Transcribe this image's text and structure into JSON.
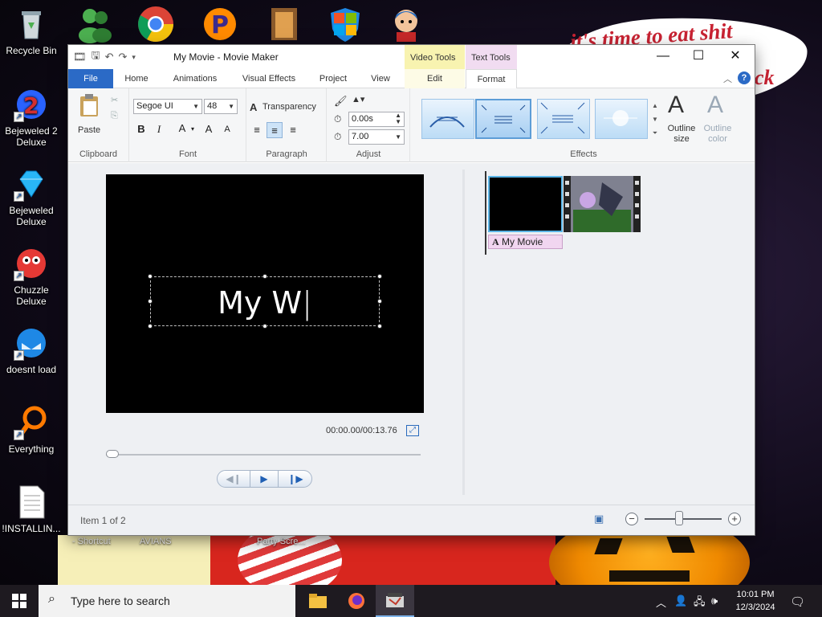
{
  "wallpaper": {
    "note_line1": "it's time to eat shit",
    "note_line2": "ck",
    "labels": [
      " - Shortcut",
      "AVIANS",
      "Party Scre..."
    ]
  },
  "desktop": {
    "icons": [
      {
        "label": "Recycle Bin"
      },
      {
        "label": "Bejeweled 2 Deluxe"
      },
      {
        "label": "Bejeweled Deluxe"
      },
      {
        "label": "Chuzzle Deluxe"
      },
      {
        "label": "doesnt load"
      },
      {
        "label": "Everything"
      },
      {
        "label": "!INSTALLIN..."
      }
    ]
  },
  "window": {
    "title": "My Movie - Movie Maker",
    "context_groups": {
      "video_tools": "Video Tools",
      "text_tools": "Text Tools"
    },
    "tabs": [
      {
        "label": "File"
      },
      {
        "label": "Home"
      },
      {
        "label": "Animations"
      },
      {
        "label": "Visual Effects"
      },
      {
        "label": "Project"
      },
      {
        "label": "View"
      },
      {
        "label": "Edit"
      },
      {
        "label": "Format"
      }
    ],
    "active_tab": "Format",
    "ribbon": {
      "clipboard": {
        "label": "Clipboard",
        "paste": "Paste"
      },
      "font": {
        "label": "Font",
        "family": "Segoe UI",
        "size": "48",
        "bold": "B",
        "italic": "I",
        "color": "A",
        "grow": "A",
        "shrink": "A"
      },
      "paragraph": {
        "label": "Paragraph",
        "transparency": "Transparency"
      },
      "adjust": {
        "label": "Adjust",
        "start_time": "0.00s",
        "duration": "7.00"
      },
      "effects": {
        "label": "Effects",
        "outline_size": "Outline size",
        "outline_color": "Outline color",
        "outline_glyph": "A"
      }
    },
    "preview": {
      "caption_text": "My W",
      "timecode": "00:00.00/00:13.76",
      "seek_position": 0
    },
    "storyboard": {
      "title_clip_label": "My Movie"
    },
    "status": {
      "item_text": "Item 1 of 2",
      "zoom_level": 0.45
    }
  },
  "taskbar": {
    "search_placeholder": "Type here to search",
    "time": "10:01 PM",
    "date": "12/3/2024"
  },
  "colors": {
    "file_tab": "#2b6ac6",
    "text_tools_group": "#f1dcf1",
    "video_tools_group": "#f8f3b0",
    "selection_border": "#5ab4e6"
  }
}
